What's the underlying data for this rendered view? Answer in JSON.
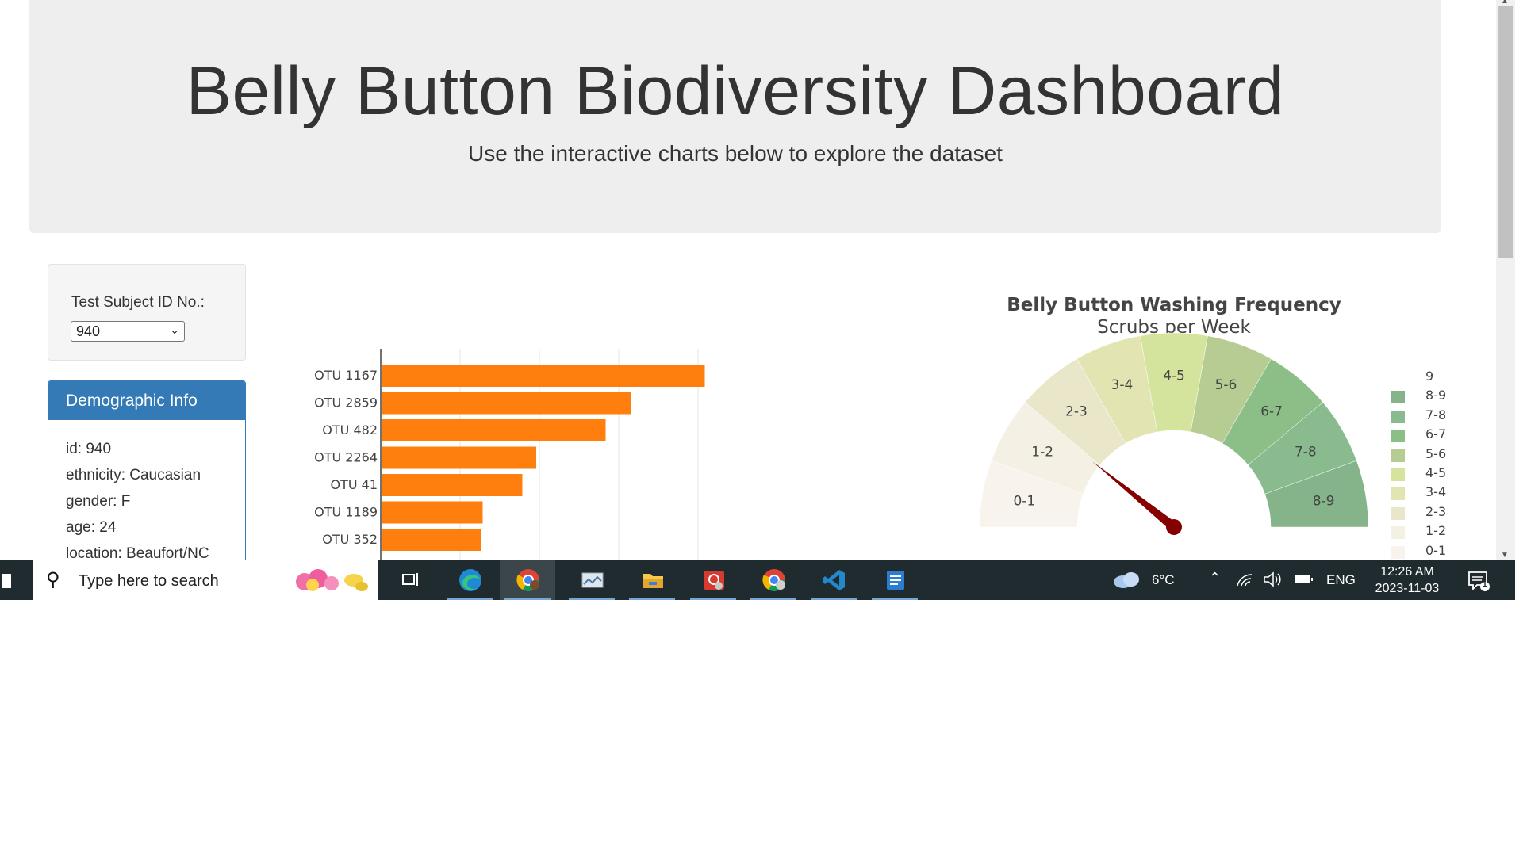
{
  "header": {
    "title": "Belly Button Biodiversity Dashboard",
    "subtitle": "Use the interactive charts below to explore the dataset"
  },
  "selector": {
    "label": "Test Subject ID No.:",
    "selected": "940"
  },
  "demographics": {
    "heading": "Demographic Info",
    "rows": [
      "id: 940",
      "ethnicity: Caucasian",
      "gender: F",
      "age: 24",
      "location: Beaufort/NC"
    ]
  },
  "bar_chart_data": {
    "type": "bar",
    "orientation": "horizontal",
    "categories": [
      "OTU 1167",
      "OTU 2859",
      "OTU 482",
      "OTU 2264",
      "OTU 41",
      "OTU 1189",
      "OTU 352"
    ],
    "values": [
      163,
      126,
      113,
      78,
      71,
      51,
      50
    ],
    "color": "#ff7f0e",
    "xlim": [
      0,
      170
    ],
    "grid": true
  },
  "gauge": {
    "title": "Belly Button Washing Frequency",
    "subtitle": "Scrubs per Week",
    "sections": [
      "0-1",
      "1-2",
      "2-3",
      "3-4",
      "4-5",
      "5-6",
      "6-7",
      "7-8",
      "8-9"
    ],
    "colors": [
      "#f8f3ec",
      "#f4f1e4",
      "#e9e6ca",
      "#e2e4b1",
      "#d5e49d",
      "#b7cc92",
      "#8cbf88",
      "#8abb8f",
      "#85b48a"
    ],
    "value": 2,
    "needle_color": "#850000"
  },
  "legend": {
    "items": [
      {
        "label": "9",
        "color": "#ffffff"
      },
      {
        "label": "8-9",
        "color": "#85b48a"
      },
      {
        "label": "7-8",
        "color": "#8abb8f"
      },
      {
        "label": "6-7",
        "color": "#8cbf88"
      },
      {
        "label": "5-6",
        "color": "#b7cc92"
      },
      {
        "label": "4-5",
        "color": "#d5e49d"
      },
      {
        "label": "3-4",
        "color": "#e2e4b1"
      },
      {
        "label": "2-3",
        "color": "#e9e6ca"
      },
      {
        "label": "1-2",
        "color": "#f4f1e4"
      },
      {
        "label": "0-1",
        "color": "#f8f3ec"
      }
    ]
  },
  "taskbar": {
    "search_placeholder": "Type here to search",
    "apps": [
      "task-view",
      "edge",
      "chrome-profile-1",
      "photos",
      "file-explorer",
      "app-red",
      "chrome-profile-2",
      "vscode",
      "word"
    ],
    "weather": "6°C",
    "language": "ENG",
    "time": "12:26 AM",
    "date": "2023-11-03",
    "notification_count": "1"
  }
}
